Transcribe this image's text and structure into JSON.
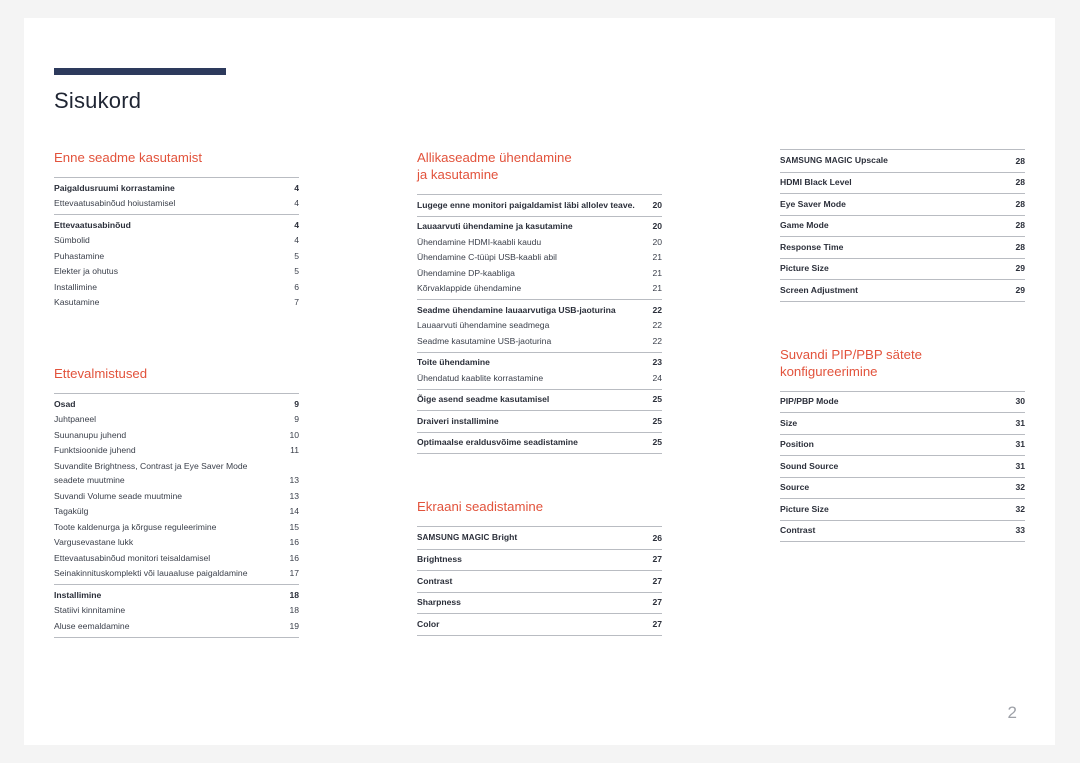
{
  "document": {
    "title": "Sisukord",
    "page_number": "2",
    "accent_bar_color": "#2d3a5c",
    "heading_color": "#e2533c",
    "text_color": "#3a3f4a",
    "rule_color": "#b9bcc2",
    "page_background": "#ffffff",
    "canvas_background": "#f4f4f4"
  },
  "columns": [
    {
      "id": "column-1",
      "sections": [
        {
          "heading": "Enne seadme kasutamist",
          "groups": [
            {
              "rows": [
                {
                  "label": "Paigaldusruumi korrastamine",
                  "page": "4",
                  "bold": true
                },
                {
                  "label": "Ettevaatusabinõud hoiustamisel",
                  "page": "4",
                  "bold": false
                }
              ]
            },
            {
              "rows": [
                {
                  "label": "Ettevaatusabinõud",
                  "page": "4",
                  "bold": true
                },
                {
                  "label": "Sümbolid",
                  "page": "4",
                  "bold": false
                },
                {
                  "label": "Puhastamine",
                  "page": "5",
                  "bold": false
                },
                {
                  "label": "Elekter ja ohutus",
                  "page": "5",
                  "bold": false
                },
                {
                  "label": "Installimine",
                  "page": "6",
                  "bold": false
                },
                {
                  "label": "Kasutamine",
                  "page": "7",
                  "bold": false
                }
              ]
            }
          ]
        },
        {
          "heading": "Ettevalmistused",
          "groups": [
            {
              "rows": [
                {
                  "label": "Osad",
                  "page": "9",
                  "bold": true
                },
                {
                  "label": "Juhtpaneel",
                  "page": "9",
                  "bold": false
                },
                {
                  "label": "Suunanupu juhend",
                  "page": "10",
                  "bold": false
                },
                {
                  "label": "Funktsioonide juhend",
                  "page": "11",
                  "bold": false
                },
                {
                  "label": "Suvandite Brightness, Contrast ja Eye Saver Mode seadete muutmine",
                  "page": "13",
                  "bold": false
                },
                {
                  "label": "Suvandi Volume seade muutmine",
                  "page": "13",
                  "bold": false
                },
                {
                  "label": "Tagakülg",
                  "page": "14",
                  "bold": false
                },
                {
                  "label": "Toote kaldenurga ja kõrguse reguleerimine",
                  "page": "15",
                  "bold": false
                },
                {
                  "label": "Vargusevastane lukk",
                  "page": "16",
                  "bold": false
                },
                {
                  "label": "Ettevaatusabinõud monitori teisaldamisel",
                  "page": "16",
                  "bold": false
                },
                {
                  "label": "Seinakinnituskomplekti või lauaaluse paigaldamine",
                  "page": "17",
                  "bold": false
                }
              ]
            },
            {
              "last": true,
              "rows": [
                {
                  "label": "Installimine",
                  "page": "18",
                  "bold": true
                },
                {
                  "label": "Statiivi kinnitamine",
                  "page": "18",
                  "bold": false
                },
                {
                  "label": "Aluse eemaldamine",
                  "page": "19",
                  "bold": false
                }
              ]
            }
          ]
        }
      ]
    },
    {
      "id": "column-2",
      "sections": [
        {
          "heading": "Allikaseadme ühendamine ja kasutamine",
          "heading_lines": [
            "Allikaseadme ühendamine",
            "ja kasutamine"
          ],
          "groups": [
            {
              "rows": [
                {
                  "label": "Lugege enne monitori paigaldamist läbi allolev teave.",
                  "page": "20",
                  "bold": true
                }
              ]
            },
            {
              "rows": [
                {
                  "label": "Lauaarvuti ühendamine ja kasutamine",
                  "page": "20",
                  "bold": true
                },
                {
                  "label": "Ühendamine HDMI-kaabli kaudu",
                  "page": "20",
                  "bold": false
                },
                {
                  "label": "Ühendamine C-tüüpi USB-kaabli abil",
                  "page": "21",
                  "bold": false
                },
                {
                  "label": "Ühendamine DP-kaabliga",
                  "page": "21",
                  "bold": false
                },
                {
                  "label": "Kõrvaklappide ühendamine",
                  "page": "21",
                  "bold": false
                }
              ]
            },
            {
              "rows": [
                {
                  "label": "Seadme ühendamine lauaarvutiga USB-jaoturina",
                  "page": "22",
                  "bold": true,
                  "tight": true
                },
                {
                  "label": "Lauaarvuti ühendamine seadmega",
                  "page": "22",
                  "bold": false
                },
                {
                  "label": "Seadme kasutamine USB-jaoturina",
                  "page": "22",
                  "bold": false
                }
              ]
            },
            {
              "rows": [
                {
                  "label": "Toite ühendamine",
                  "page": "23",
                  "bold": true
                },
                {
                  "label": "Ühendatud kaablite korrastamine",
                  "page": "24",
                  "bold": false
                }
              ]
            },
            {
              "rows": [
                {
                  "label": "Õige asend seadme kasutamisel",
                  "page": "25",
                  "bold": true
                }
              ]
            },
            {
              "rows": [
                {
                  "label": "Draiveri installimine",
                  "page": "25",
                  "bold": true
                }
              ]
            },
            {
              "last": true,
              "rows": [
                {
                  "label": "Optimaalse eraldusvõime seadistamine",
                  "page": "25",
                  "bold": true
                }
              ]
            }
          ]
        },
        {
          "heading": "Ekraani seadistamine",
          "groups": [
            {
              "rows": [
                {
                  "label": "SAMSUNG MAGIC Bright",
                  "page": "26",
                  "bold": true,
                  "brand": "SAMSUNG MAGIC",
                  "rest": " Bright"
                }
              ]
            },
            {
              "rows": [
                {
                  "label": "Brightness",
                  "page": "27",
                  "bold": true
                }
              ]
            },
            {
              "rows": [
                {
                  "label": "Contrast",
                  "page": "27",
                  "bold": true
                }
              ]
            },
            {
              "rows": [
                {
                  "label": "Sharpness",
                  "page": "27",
                  "bold": true
                }
              ]
            },
            {
              "last": true,
              "rows": [
                {
                  "label": "Color",
                  "page": "27",
                  "bold": true
                }
              ]
            }
          ]
        }
      ]
    },
    {
      "id": "column-3",
      "sections": [
        {
          "heading": "",
          "groups": [
            {
              "rows": [
                {
                  "label": "SAMSUNG MAGIC Upscale",
                  "page": "28",
                  "bold": true,
                  "brand": "SAMSUNG MAGIC",
                  "rest": " Upscale"
                }
              ]
            },
            {
              "rows": [
                {
                  "label": "HDMI Black Level",
                  "page": "28",
                  "bold": true
                }
              ]
            },
            {
              "rows": [
                {
                  "label": "Eye Saver Mode",
                  "page": "28",
                  "bold": true
                }
              ]
            },
            {
              "rows": [
                {
                  "label": "Game Mode",
                  "page": "28",
                  "bold": true
                }
              ]
            },
            {
              "rows": [
                {
                  "label": "Response Time",
                  "page": "28",
                  "bold": true
                }
              ]
            },
            {
              "rows": [
                {
                  "label": "Picture Size",
                  "page": "29",
                  "bold": true
                }
              ]
            },
            {
              "last": true,
              "rows": [
                {
                  "label": "Screen Adjustment",
                  "page": "29",
                  "bold": true
                }
              ]
            }
          ]
        },
        {
          "heading": "Suvandi PIP/PBP sätete konfigureerimine",
          "heading_lines": [
            "Suvandi PIP/PBP sätete",
            "konfigureerimine"
          ],
          "groups": [
            {
              "rows": [
                {
                  "label": "PIP/PBP Mode",
                  "page": "30",
                  "bold": true
                }
              ]
            },
            {
              "rows": [
                {
                  "label": "Size",
                  "page": "31",
                  "bold": true
                }
              ]
            },
            {
              "rows": [
                {
                  "label": "Position",
                  "page": "31",
                  "bold": true
                }
              ]
            },
            {
              "rows": [
                {
                  "label": "Sound Source",
                  "page": "31",
                  "bold": true
                }
              ]
            },
            {
              "rows": [
                {
                  "label": "Source",
                  "page": "32",
                  "bold": true
                }
              ]
            },
            {
              "rows": [
                {
                  "label": "Picture Size",
                  "page": "32",
                  "bold": true
                }
              ]
            },
            {
              "last": true,
              "rows": [
                {
                  "label": "Contrast",
                  "page": "33",
                  "bold": true
                }
              ]
            }
          ]
        }
      ]
    }
  ]
}
